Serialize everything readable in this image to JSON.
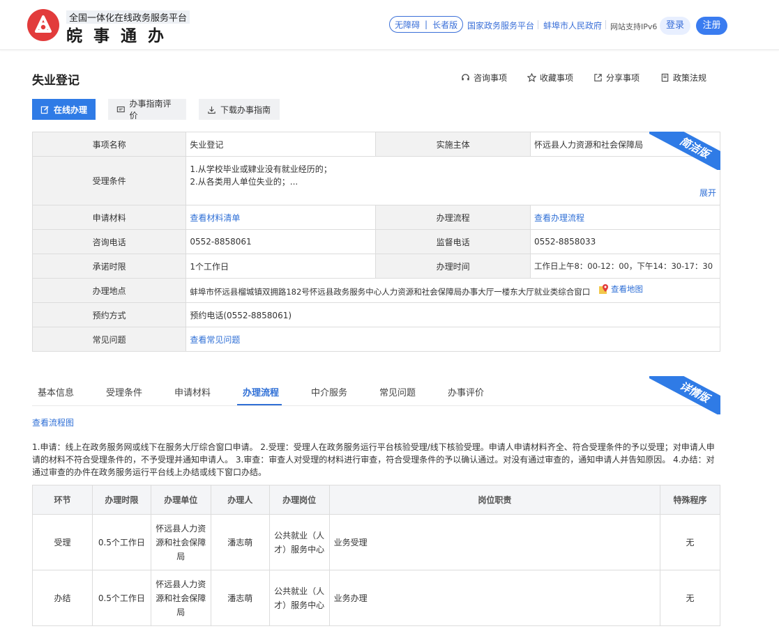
{
  "header": {
    "brand_sub": "全国一体化在线政务服务平台",
    "brand_main": "皖事通办",
    "accessibility": "无障碍",
    "elder": "长者版",
    "link_national": "国家政务服务平台",
    "link_city": "蚌埠市人民政府",
    "ipv6": "网站支持IPv6",
    "login": "登录",
    "register": "注册"
  },
  "page": {
    "title": "失业登记",
    "actions": {
      "consult": "咨询事项",
      "favorite": "收藏事项",
      "share": "分享事项",
      "policy": "政策法规"
    },
    "buttons": {
      "online": "在线办理",
      "evaluate": "办事指南评价",
      "download": "下载办事指南"
    }
  },
  "summary": {
    "ribbon": "简洁版",
    "item_name_label": "事项名称",
    "item_name": "失业登记",
    "subject_label": "实施主体",
    "subject": "怀远县人力资源和社会保障局",
    "conditions_label": "受理条件",
    "conditions_line1": "1.从学校毕业或肄业没有就业经历的；",
    "conditions_line2": "2.从各类用人单位失业的；...",
    "expand": "展开",
    "materials_label": "申请材料",
    "materials_link": "查看材料清单",
    "process_label": "办理流程",
    "process_link": "查看办理流程",
    "phone_label": "咨询电话",
    "phone": "0552-8858061",
    "supervise_label": "监督电话",
    "supervise": "0552-8858033",
    "promise_label": "承诺时限",
    "promise": "1个工作日",
    "hours_label": "办理时间",
    "hours": "工作日上午8：00-12：00，下午14：30-17：30",
    "address_label": "办理地点",
    "address": "蚌埠市怀远县榴城镇双拥路182号怀远县政务服务中心人力资源和社会保障局办事大厅一楼东大厅就业类综合窗口",
    "map_link": "查看地图",
    "booking_label": "预约方式",
    "booking": "预约电话(0552-8858061)",
    "faq_label": "常见问题",
    "faq_link": "查看常见问题"
  },
  "tabs": {
    "ribbon": "详情版",
    "items": [
      "基本信息",
      "受理条件",
      "申请材料",
      "办理流程",
      "中介服务",
      "常见问题",
      "办事评价"
    ]
  },
  "flow": {
    "link": "查看流程图",
    "text": "1.申请：线上在政务服务网或线下在服务大厅综合窗口申请。 2.受理：受理人在政务服务运行平台核验受理/线下核验受理。申请人申请材料齐全、符合受理条件的予以受理；对申请人申请的材料不符合受理条件的，不予受理并通知申请人。 3.审查：审查人对受理的材料进行审查，符合受理条件的予以确认通过。对没有通过审查的，通知申请人并告知原因。 4.办结：对通过审查的办件在政务服务运行平台线上办结或线下窗口办结。"
  },
  "process_table": {
    "headers": [
      "环节",
      "办理时限",
      "办理单位",
      "办理人",
      "办理岗位",
      "岗位职责",
      "特殊程序"
    ],
    "rows": [
      [
        "受理",
        "0.5个工作日",
        "怀远县人力资源和社会保障局",
        "潘志萌",
        "公共就业（人才）服务中心",
        "业务受理",
        "无"
      ],
      [
        "办结",
        "0.5个工作日",
        "怀远县人力资源和社会保障局",
        "潘志萌",
        "公共就业（人才）服务中心",
        "业务办理",
        "无"
      ]
    ]
  },
  "colors": {
    "primary": "#2f7be6",
    "link": "#2f6fd6",
    "logo": "#e23b3b"
  }
}
